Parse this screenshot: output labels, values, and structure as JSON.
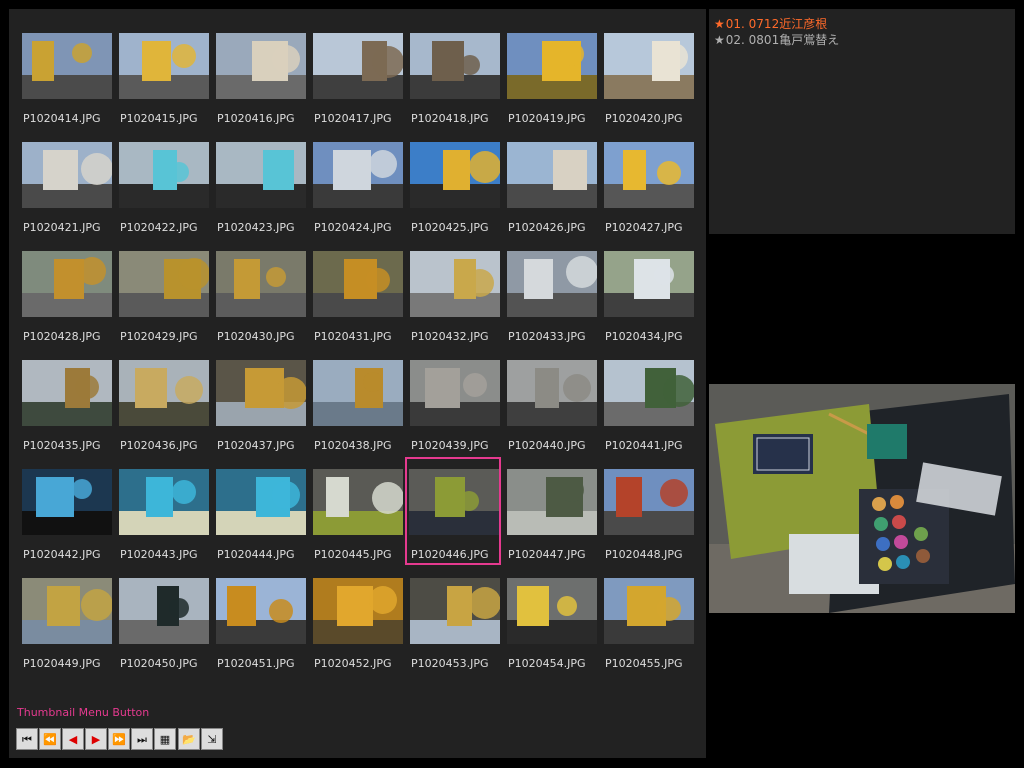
{
  "albums": [
    {
      "label": "01. 0712近江彦根",
      "color": "#ff6a2a"
    },
    {
      "label": "02. 0801亀戸鴬替え",
      "color": "#b0b0b0"
    }
  ],
  "thumbnails": [
    "P1020414.JPG",
    "P1020415.JPG",
    "P1020416.JPG",
    "P1020417.JPG",
    "P1020418.JPG",
    "P1020419.JPG",
    "P1020420.JPG",
    "P1020421.JPG",
    "P1020422.JPG",
    "P1020423.JPG",
    "P1020424.JPG",
    "P1020425.JPG",
    "P1020426.JPG",
    "P1020427.JPG",
    "P1020428.JPG",
    "P1020429.JPG",
    "P1020430.JPG",
    "P1020431.JPG",
    "P1020432.JPG",
    "P1020433.JPG",
    "P1020434.JPG",
    "P1020435.JPG",
    "P1020436.JPG",
    "P1020437.JPG",
    "P1020438.JPG",
    "P1020439.JPG",
    "P1020440.JPG",
    "P1020441.JPG",
    "P1020442.JPG",
    "P1020443.JPG",
    "P1020444.JPG",
    "P1020445.JPG",
    "P1020446.JPG",
    "P1020447.JPG",
    "P1020448.JPG",
    "P1020449.JPG",
    "P1020450.JPG",
    "P1020451.JPG",
    "P1020452.JPG",
    "P1020453.JPG",
    "P1020454.JPG",
    "P1020455.JPG"
  ],
  "selected": "P1020446.JPG",
  "menu": {
    "label": "Thumbnail Menu Button",
    "buttons": [
      {
        "name": "first-page-button",
        "icon": "first-icon",
        "glyph": "⏮",
        "red": false
      },
      {
        "name": "prev-page-button",
        "icon": "rewind-icon",
        "glyph": "⏪",
        "red": false
      },
      {
        "name": "prev-button",
        "icon": "play-left-icon",
        "glyph": "◀",
        "red": true
      },
      {
        "name": "next-button",
        "icon": "play-right-icon",
        "glyph": "▶",
        "red": true
      },
      {
        "name": "next-page-button",
        "icon": "fast-forward-icon",
        "glyph": "⏩",
        "red": false
      },
      {
        "name": "last-page-button",
        "icon": "last-icon",
        "glyph": "⏭",
        "red": false
      },
      {
        "name": "grid-view-button",
        "icon": "grid-icon",
        "glyph": "▦",
        "red": false
      },
      {
        "name": "open-folder-button",
        "icon": "folder-icon",
        "glyph": "📂",
        "red": false
      },
      {
        "name": "exit-button",
        "icon": "exit-icon",
        "glyph": "⇲",
        "red": false
      }
    ]
  },
  "colors": {
    "accent": "#e53a8f",
    "panel": "#222222",
    "background": "#000000"
  }
}
